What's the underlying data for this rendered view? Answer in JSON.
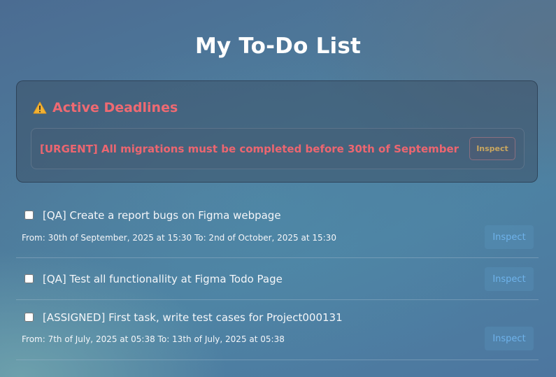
{
  "page": {
    "title": "My To-Do List"
  },
  "deadlines": {
    "icon": "warning-icon",
    "title": "Active Deadlines",
    "items": [
      {
        "text": "[URGENT] All migrations must be completed before 30th of September",
        "inspect_label": "Inspect"
      }
    ]
  },
  "tasks": [
    {
      "checked": false,
      "title": "[QA] Create a report bugs on Figma webpage",
      "dates": "From: 30th of September, 2025 at 15:30 To: 2nd of October, 2025 at 15:30",
      "inspect_label": "Inspect"
    },
    {
      "checked": false,
      "title": "[QA] Test all functionallity at Figma Todo Page",
      "dates": "",
      "inspect_label": "Inspect"
    },
    {
      "checked": false,
      "title": "[ASSIGNED] First task, write test cases for Project000131",
      "dates": "From: 7th of July, 2025 at 05:38 To: 13th of July, 2025 at 05:38",
      "inspect_label": "Inspect"
    }
  ],
  "colors": {
    "deadline_accent": "#ef6a72",
    "inspect_text": "#6eb2ea",
    "urgent_inspect_text": "#c9a65f"
  }
}
